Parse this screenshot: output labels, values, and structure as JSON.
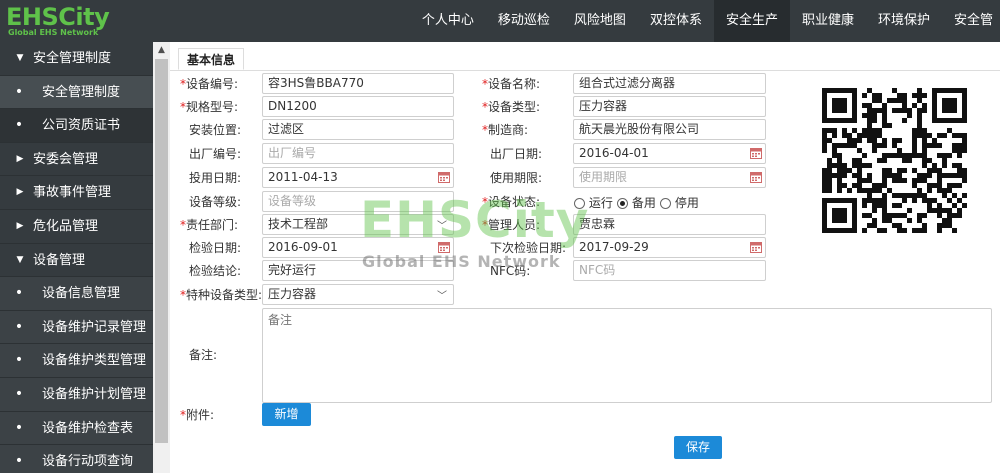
{
  "header": {
    "logo_text": "EHSCity",
    "logo_sub": "Global EHS Network",
    "nav": [
      "个人中心",
      "移动巡检",
      "风险地图",
      "双控体系",
      "安全生产",
      "职业健康",
      "环境保护",
      "安全管"
    ]
  },
  "sidebar": {
    "items": [
      {
        "label": "安全管理制度",
        "type": "group",
        "mark": "▼"
      },
      {
        "label": "安全管理制度",
        "type": "sub",
        "mark": "•"
      },
      {
        "label": "公司资质证书",
        "type": "sub",
        "mark": "•"
      },
      {
        "label": "安委会管理",
        "type": "group",
        "mark": "▶"
      },
      {
        "label": "事故事件管理",
        "type": "group",
        "mark": "▶"
      },
      {
        "label": "危化品管理",
        "type": "group",
        "mark": "▶"
      },
      {
        "label": "设备管理",
        "type": "group",
        "mark": "▼"
      },
      {
        "label": "设备信息管理",
        "type": "sub",
        "mark": "•"
      },
      {
        "label": "设备维护记录管理",
        "type": "sub",
        "mark": "•"
      },
      {
        "label": "设备维护类型管理",
        "type": "sub",
        "mark": "•"
      },
      {
        "label": "设备维护计划管理",
        "type": "sub",
        "mark": "•"
      },
      {
        "label": "设备维护检查表",
        "type": "sub",
        "mark": "•"
      },
      {
        "label": "设备行动项查询",
        "type": "sub",
        "mark": "•"
      }
    ]
  },
  "tab": {
    "label": "基本信息"
  },
  "form": {
    "device_no": {
      "label": "设备编号:",
      "value": "容3HS鲁BBA770"
    },
    "device_name": {
      "label": "设备名称:",
      "value": "组合式过滤分离器"
    },
    "spec_model": {
      "label": "规格型号:",
      "value": "DN1200"
    },
    "device_type": {
      "label": "设备类型:",
      "value": "压力容器"
    },
    "install_location": {
      "label": "安装位置:",
      "value": "过滤区"
    },
    "manufacturer": {
      "label": "制造商:",
      "value": "航天晨光股份有限公司"
    },
    "factory_no": {
      "label": "出厂编号:",
      "placeholder": "出厂编号"
    },
    "factory_date": {
      "label": "出厂日期:",
      "value": "2016-04-01"
    },
    "commission_date": {
      "label": "投用日期:",
      "value": "2011-04-13"
    },
    "service_life": {
      "label": "使用期限:",
      "placeholder": "使用期限"
    },
    "device_grade": {
      "label": "设备等级:",
      "placeholder": "设备等级"
    },
    "device_status": {
      "label": "设备状态:",
      "options": [
        "运行",
        "备用",
        "停用"
      ],
      "selected": "备用"
    },
    "department": {
      "label": "责任部门:",
      "value": "技术工程部"
    },
    "manager": {
      "label": "管理人员:",
      "value": "贾忠霖"
    },
    "inspection_date": {
      "label": "检验日期:",
      "value": "2016-09-01"
    },
    "next_inspection_date": {
      "label": "下次检验日期:",
      "value": "2017-09-29"
    },
    "inspection_result": {
      "label": "检验结论:",
      "value": "完好运行"
    },
    "nfc": {
      "label": "NFC码:",
      "placeholder": "NFC码"
    },
    "special_type": {
      "label": "特种设备类型:",
      "value": "压力容器"
    },
    "remarks": {
      "label": "备注:",
      "placeholder": "备注"
    },
    "attachment": {
      "label": "附件:",
      "add_label": "新增"
    }
  },
  "actions": {
    "save_label": "保存"
  },
  "watermark": {
    "big": "EHSCity",
    "small": "Global EHS Network"
  },
  "colors": {
    "topbar": "#353b3f",
    "accent_green": "#5fc24a",
    "button_blue": "#1c8ad8",
    "required_red": "#e02020"
  }
}
